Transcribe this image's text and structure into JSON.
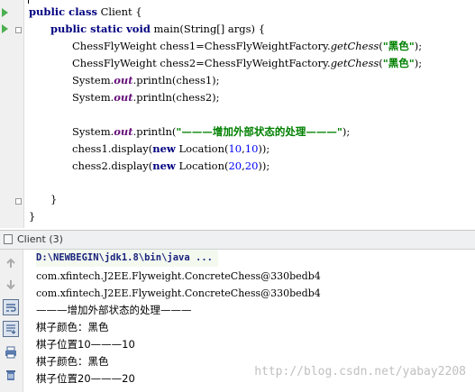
{
  "editor": {
    "lines": {
      "l1_kw": "public class",
      "l1_rest": " Client {",
      "l2_kw1": "public static void",
      "l2_rest": " main(String[] args) {",
      "l3_a": "ChessFlyWeight chess1=ChessFlyWeightFactory.",
      "l3_method": "getChess",
      "l3_b": "(",
      "l3_str": "\"黑色\"",
      "l3_c": ");",
      "l4_a": "ChessFlyWeight chess2=ChessFlyWeightFactory.",
      "l4_method": "getChess",
      "l4_b": "(",
      "l4_str": "\"黑色\"",
      "l4_c": ");",
      "l5_a": "System.",
      "l5_field": "out",
      "l5_b": ".println(chess1);",
      "l6_a": "System.",
      "l6_field": "out",
      "l6_b": ".println(chess2);",
      "l7_a": "System.",
      "l7_field": "out",
      "l7_b": ".println(",
      "l7_str": "\"———增加外部状态的处理———\"",
      "l7_c": ");",
      "l8_a": "chess1.display(",
      "l8_kw": "new",
      "l8_b": " Location(",
      "l8_n1": "10",
      "l8_sep": ",",
      "l8_n2": "10",
      "l8_c": "));",
      "l9_a": "chess2.display(",
      "l9_kw": "new",
      "l9_b": " Location(",
      "l9_n1": "20",
      "l9_sep": ",",
      "l9_n2": "20",
      "l9_c": "));",
      "l10": "}",
      "l11": "}"
    }
  },
  "console": {
    "title": "Client (3)",
    "output": [
      "D:\\NEWBEGIN\\jdk1.8\\bin\\java ...",
      "com.xfintech.J2EE.Flyweight.ConcreteChess@330bedb4",
      "com.xfintech.J2EE.Flyweight.ConcreteChess@330bedb4",
      "———增加外部状态的处理———",
      "棋子颜色：黑色",
      "棋子位置10———10",
      "棋子颜色：黑色",
      "棋子位置20———20"
    ],
    "watermark": "http://blog.csdn.net/yabay2208"
  },
  "colors": {
    "keyword": "#000080",
    "string": "#008000",
    "number": "#0000ff",
    "field": "#660e7a",
    "run_arrow": "#4caf50"
  },
  "icons": {
    "toolbar": [
      "arrow-up-icon",
      "arrow-down-icon",
      "soft-wrap-icon",
      "scroll-to-end-icon",
      "print-icon",
      "trash-icon"
    ]
  }
}
